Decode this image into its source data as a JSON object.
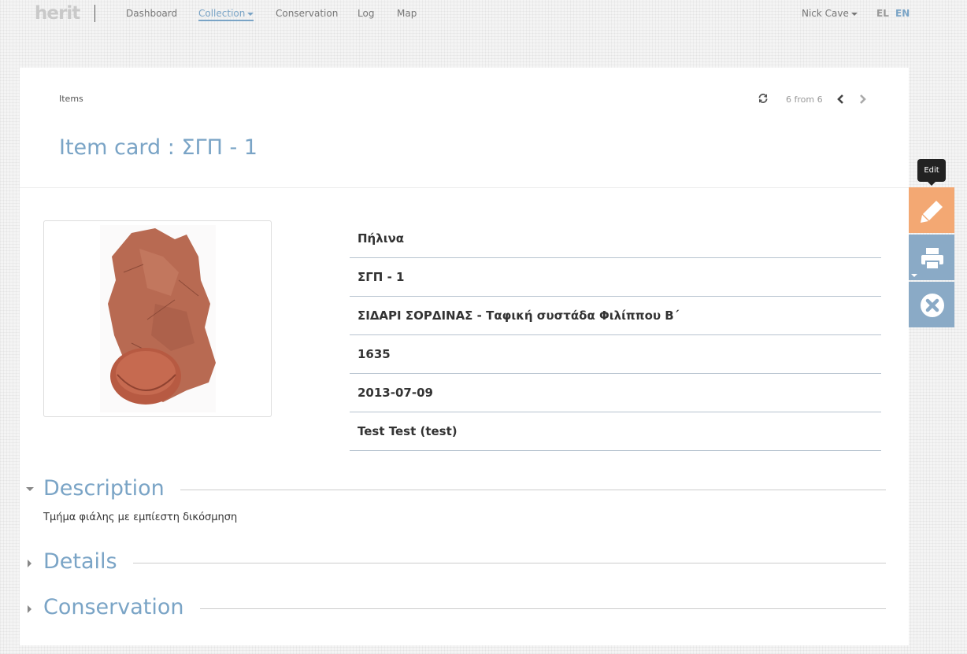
{
  "nav": {
    "logo": "herit",
    "items": [
      "Dashboard",
      "Collection",
      "Conservation",
      "Log",
      "Map"
    ],
    "active": "Collection",
    "user": "Nick Cave",
    "lang_el": "EL",
    "lang_en": "EN"
  },
  "header": {
    "breadcrumb": "Items",
    "pager": "6 from 6",
    "title": "Item card : ΣΓΠ - 1"
  },
  "attributes": [
    "Πήλινα",
    "ΣΓΠ - 1",
    "ΣΙΔΑΡΙ ΣΟΡΔΙΝΑΣ - Ταφική συστάδα Φιλίππου Β΄",
    "1635",
    "2013-07-09",
    "Test Test (test)"
  ],
  "sections": {
    "description": {
      "title": "Description",
      "text": "Τμήμα φιάλης με εμπίεστη δικόσμηση"
    },
    "details": {
      "title": "Details"
    },
    "conservation": {
      "title": "Conservation"
    }
  },
  "actions": {
    "edit_tooltip": "Edit"
  },
  "colors": {
    "accent": "#7aa4c6",
    "edit": "#f3a873",
    "action": "#8aaac6"
  }
}
